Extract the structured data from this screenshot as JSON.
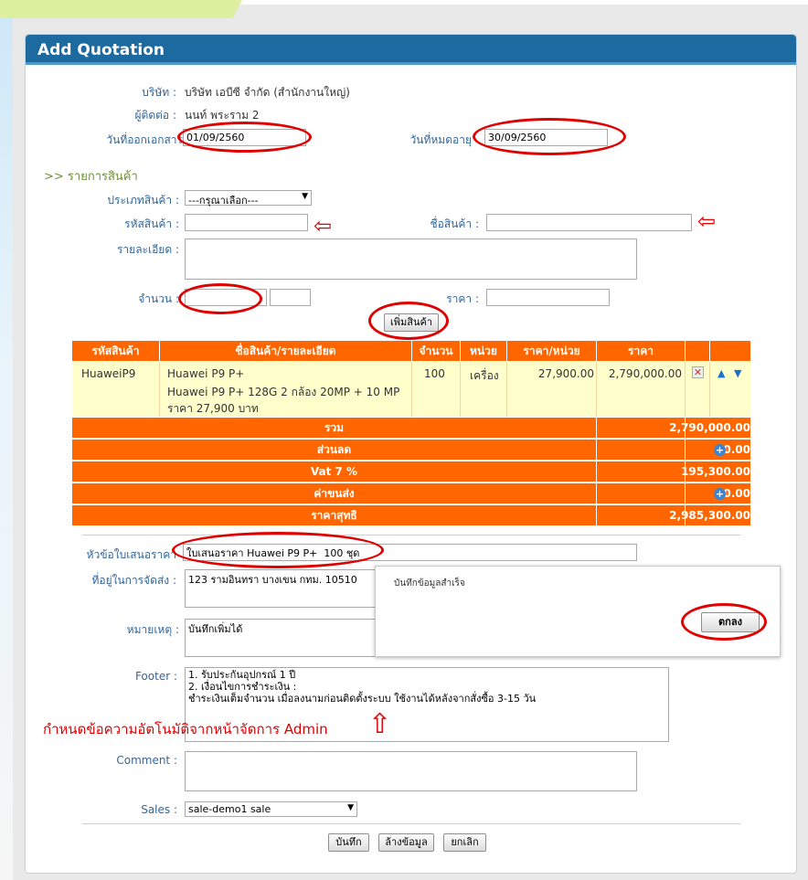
{
  "page": {
    "title": "Add Quotation"
  },
  "company": {
    "label": "บริษัท :",
    "value": "บริษัท เอบีซี จำกัด (สำนักงานใหญ่)"
  },
  "contact": {
    "label": "ผู้ติดต่อ :",
    "value": "นนท์ พระราม 2"
  },
  "issue_date": {
    "label": "วันที่ออกเอกสาร",
    "value": "01/09/2560"
  },
  "expiry_date": {
    "label": "วันที่หมดอายุ",
    "value": "30/09/2560"
  },
  "items_section": {
    "title": ">> รายการสินค้า"
  },
  "product_form": {
    "type_label": "ประเภทสินค้า :",
    "type_value": "---กรุณาเลือก---",
    "code_label": "รหัสสินค้า :",
    "name_label": "ชื่อสินค้า :",
    "detail_label": "รายละเอียด :",
    "qty_label": "จำนวน :",
    "price_label": "ราคา :",
    "add_button": "เพิ่มสินค้า"
  },
  "table": {
    "headers": [
      "รหัสสินค้า",
      "ชื่อสินค้า/รายละเอียด",
      "จำนวน",
      "หน่วย",
      "ราคา/หน่วย",
      "ราคา"
    ],
    "rows": [
      {
        "code": "HuaweiP9",
        "name_lines": [
          "Huawei P9 P+",
          "Huawei P9 P+ 128G 2 กล้อง 20MP + 10 MP",
          "ราคา 27,900 บาท"
        ],
        "qty": "100",
        "unit": "เครื่อง",
        "unit_price": "27,900.00",
        "price": "2,790,000.00"
      }
    ],
    "summary": [
      {
        "label": "รวม",
        "value": "2,790,000.00"
      },
      {
        "label": "ส่วนลด",
        "value": "0.00"
      },
      {
        "label": "Vat 7 %",
        "value": "195,300.00"
      },
      {
        "label": "ค่าขนส่ง",
        "value": "0.00"
      },
      {
        "label": "ราคาสุทธิ",
        "value": "2,985,300.00"
      }
    ]
  },
  "quote_subject": {
    "label": "หัวข้อใบเสนอราคา",
    "value": "ใบเสนอราคา Huawei P9 P+  100 ชุด"
  },
  "shipping_address": {
    "label": "ที่อยู่ในการจัดส่ง :",
    "value": "123 รามอินทรา บางเขน กทม. 10510"
  },
  "remark": {
    "label": "หมายเหตุ :",
    "value": "บันทึกเพิ่มได้"
  },
  "footer_field": {
    "label": "Footer :",
    "value": "1. รับประกันอุปกรณ์ 1 ปี\n2. เงื่อนไขการชำระเงิน :\nชำระเงินเต็มจำนวน เมื่อลงนามก่อนติดตั้งระบบ ใช้งานได้หลังจากสั่งซื้อ 3-15 วัน"
  },
  "annotation": {
    "admin_note": "กำหนดข้อความอัตโนมัติจากหน้าจัดการ Admin"
  },
  "comment": {
    "label": "Comment :",
    "value": ""
  },
  "sales": {
    "label": "Sales :",
    "value": "sale-demo1 sale"
  },
  "dialog": {
    "message": "บันทึกข้อมูลสำเร็จ",
    "ok_button": "ตกลง"
  },
  "actions": {
    "save": "บันทึก",
    "clear": "ล้างข้อมูล",
    "cancel": "ยกเลิก"
  },
  "colors": {
    "header": "#1d6aa0",
    "table_header": "#ff6600",
    "row_bg": "#ffffcc",
    "annotation": "#e00000"
  }
}
